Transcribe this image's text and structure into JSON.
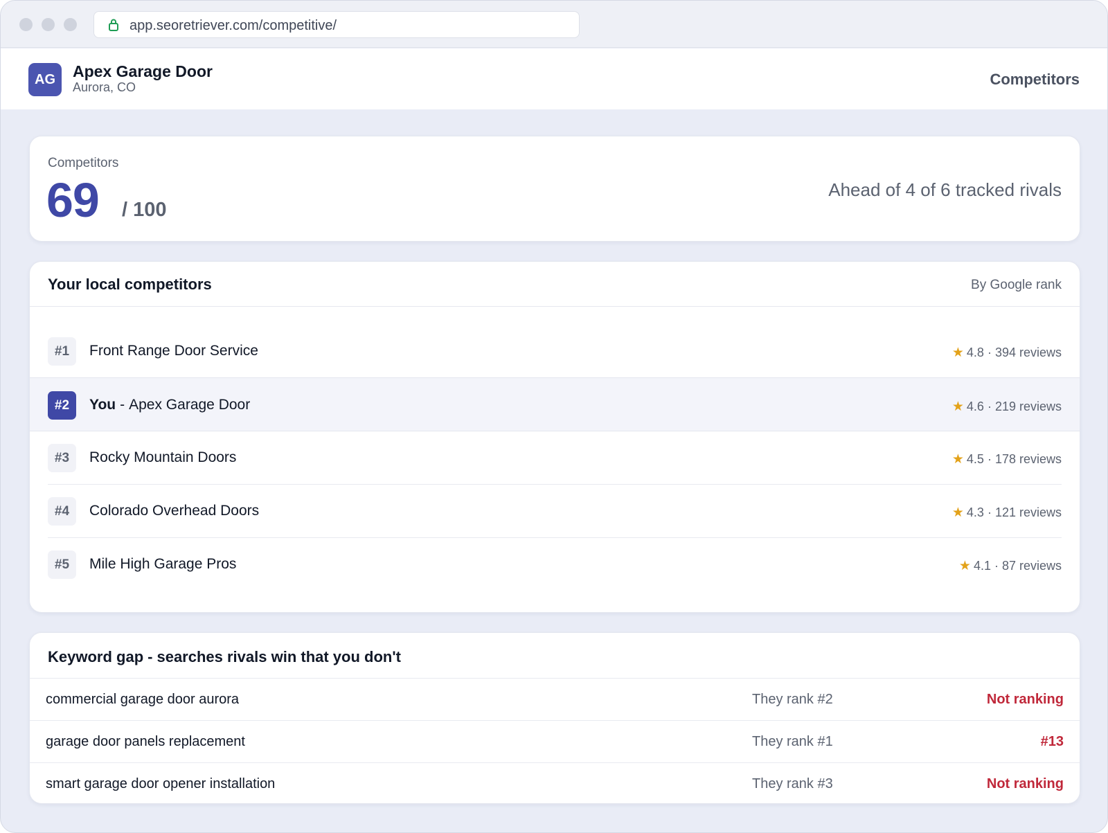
{
  "browser": {
    "url": "app.seoretriever.com/competitive/"
  },
  "header": {
    "avatar_initials": "AG",
    "business_name": "Apex Garage Door",
    "location": "Aurora, CO",
    "nav_label": "Competitors"
  },
  "score": {
    "label": "Competitors",
    "value": "69",
    "max": "/ 100",
    "summary": "Ahead of 4 of 6 tracked rivals"
  },
  "competitors": {
    "title": "Your local competitors",
    "sort_label": "By Google rank",
    "you_label": "You",
    "rows": [
      {
        "rank": "#1",
        "name": "Front Range Door Service",
        "rating": "4.8 · 394 reviews"
      },
      {
        "rank": "#2",
        "name": "Apex Garage Door",
        "rating": "4.6 · 219 reviews"
      },
      {
        "rank": "#3",
        "name": "Rocky Mountain Doors",
        "rating": "4.5 · 178 reviews"
      },
      {
        "rank": "#4",
        "name": "Colorado Overhead Doors",
        "rating": "4.3 · 121 reviews"
      },
      {
        "rank": "#5",
        "name": "Mile High Garage Pros",
        "rating": "4.1 · 87 reviews"
      }
    ]
  },
  "keyword_gap": {
    "title": "Keyword gap",
    "subtitle": "searches rivals win that you don't",
    "rows": [
      {
        "keyword": "commercial garage door aurora",
        "rival_rank": "They rank #2",
        "your_rank": "Not ranking"
      },
      {
        "keyword": "garage door panels replacement",
        "rival_rank": "They rank #1",
        "your_rank": "#13"
      },
      {
        "keyword": "smart garage door opener installation",
        "rival_rank": "They rank #3",
        "your_rank": "Not ranking"
      }
    ]
  },
  "colors": {
    "accent": "#3f48a6",
    "star": "#e3a21a",
    "negative": "#c0283a",
    "background": "#e9ecf6"
  }
}
